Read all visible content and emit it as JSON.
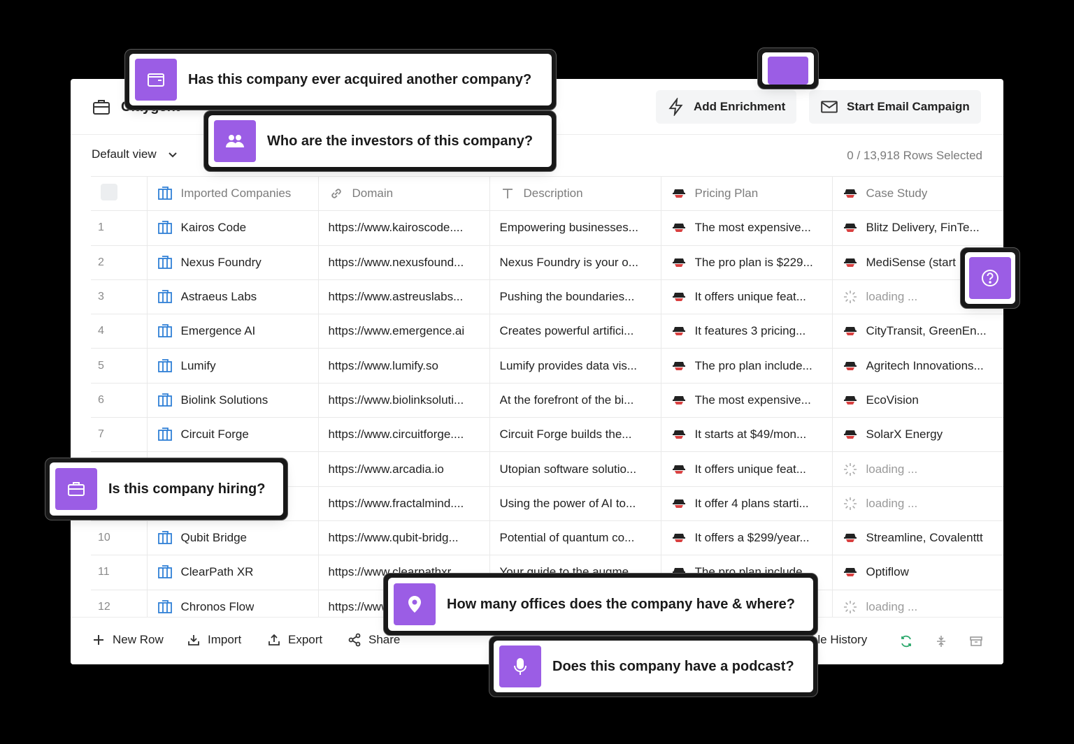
{
  "app": {
    "name": "Claygent"
  },
  "header": {
    "add_enrichment": "Add Enrichment",
    "start_email_campaign": "Start Email Campaign"
  },
  "view": {
    "selected": "Default view",
    "rows_selected": "0 / 13,918 Rows Selected"
  },
  "table": {
    "columns": [
      "Imported Companies",
      "Domain",
      "Description",
      "Pricing Plan",
      "Case Study"
    ],
    "rows": [
      {
        "num": "1",
        "company": "Kairos Code",
        "domain": "https://www.kairoscode....",
        "description": "Empowering businesses...",
        "pricing": "The most expensive...",
        "case_study": "Blitz Delivery, FinTe..."
      },
      {
        "num": "2",
        "company": "Nexus Foundry",
        "domain": "https://www.nexusfound...",
        "description": "Nexus Foundry is your o...",
        "pricing": "The pro plan is $229...",
        "case_study": "MediSense (start"
      },
      {
        "num": "3",
        "company": "Astraeus Labs",
        "domain": "https://www.astreuslabs...",
        "description": "Pushing the boundaries...",
        "pricing": "It offers unique feat...",
        "case_study": "loading ..."
      },
      {
        "num": "4",
        "company": "Emergence AI",
        "domain": "https://www.emergence.ai",
        "description": "Creates powerful artifici...",
        "pricing": "It features 3 pricing...",
        "case_study": "CityTransit, GreenEn..."
      },
      {
        "num": "5",
        "company": "Lumify",
        "domain": "https://www.lumify.so",
        "description": "Lumify provides data vis...",
        "pricing": "The pro plan include...",
        "case_study": "Agritech Innovations..."
      },
      {
        "num": "6",
        "company": "Biolink Solutions",
        "domain": "https://www.biolinksoluti...",
        "description": "At the forefront of the bi...",
        "pricing": "The most expensive...",
        "case_study": "EcoVision"
      },
      {
        "num": "7",
        "company": "Circuit Forge",
        "domain": "https://www.circuitforge....",
        "description": "Circuit Forge builds the...",
        "pricing": "It starts at $49/mon...",
        "case_study": "SolarX Energy"
      },
      {
        "num": "",
        "company": "",
        "domain": "https://www.arcadia.io",
        "description": "Utopian software solutio...",
        "pricing": "It offers unique feat...",
        "case_study": "loading ..."
      },
      {
        "num": "",
        "company": "",
        "domain": "https://www.fractalmind....",
        "description": "Using the power of AI to...",
        "pricing": "It offer 4 plans starti...",
        "case_study": "loading ..."
      },
      {
        "num": "10",
        "company": "Qubit Bridge",
        "domain": "https://www.qubit-bridg...",
        "description": "Potential of quantum co...",
        "pricing": "It offers a $299/year...",
        "case_study": "Streamline, Covalenttt"
      },
      {
        "num": "11",
        "company": "ClearPath XR",
        "domain": "https://www.clearpathxr...",
        "description": "Your guide to the augme...",
        "pricing": "The pro plan include...",
        "case_study": "Optiflow"
      },
      {
        "num": "12",
        "company": "Chronos Flow",
        "domain": "https://www...",
        "description": "",
        "pricing": "",
        "case_study": "loading ..."
      }
    ]
  },
  "footer": {
    "new_row": "New Row",
    "import": "Import",
    "export": "Export",
    "share": "Share",
    "view_history": "View Table History"
  },
  "prompts": {
    "acquired": "Has this company ever acquired another company?",
    "investors": "Who are the investors of this company?",
    "hiring": "Is this company hiring?",
    "offices": "How many offices does the company have & where?",
    "podcast": "Does this company have a podcast?"
  },
  "colors": {
    "accent": "#9b5de5",
    "table_icon": "#2f7fd6"
  }
}
